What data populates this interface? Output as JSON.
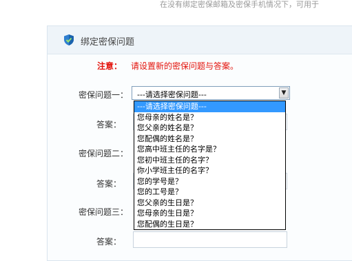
{
  "top_note": "在没有绑定密保邮箱及密保手机情况下，可用于",
  "panel": {
    "title": "绑定密保问题",
    "icon": "shield-icon"
  },
  "notice": {
    "label": "注意：",
    "text": "请设置新的密保问题与答案。"
  },
  "form": {
    "question1_label": "密保问题一：",
    "answer1_label": "答案：",
    "question2_label": "密保问题二：",
    "answer2_label": "答案：",
    "question3_label": "密保问题三：",
    "answer3_label": "答案：",
    "question1_value": "---请选择密保问题---"
  },
  "dropdown": {
    "options": [
      "---请选择密保问题---",
      "您母亲的姓名是？",
      "您父亲的姓名是？",
      "您配偶的姓名是？",
      "您高中班主任的名字是？",
      "您初中班主任的名字？",
      "你小学班主任的名字？",
      "您的学号是？",
      "您的工号是？",
      "您父亲的生日是？",
      "您母亲的生日是？",
      "您配偶的生日是？"
    ],
    "selected_index": 0
  },
  "colors": {
    "notice": "#e3120b",
    "highlight": "#3399ff",
    "panel_header": "#eef4f9"
  }
}
